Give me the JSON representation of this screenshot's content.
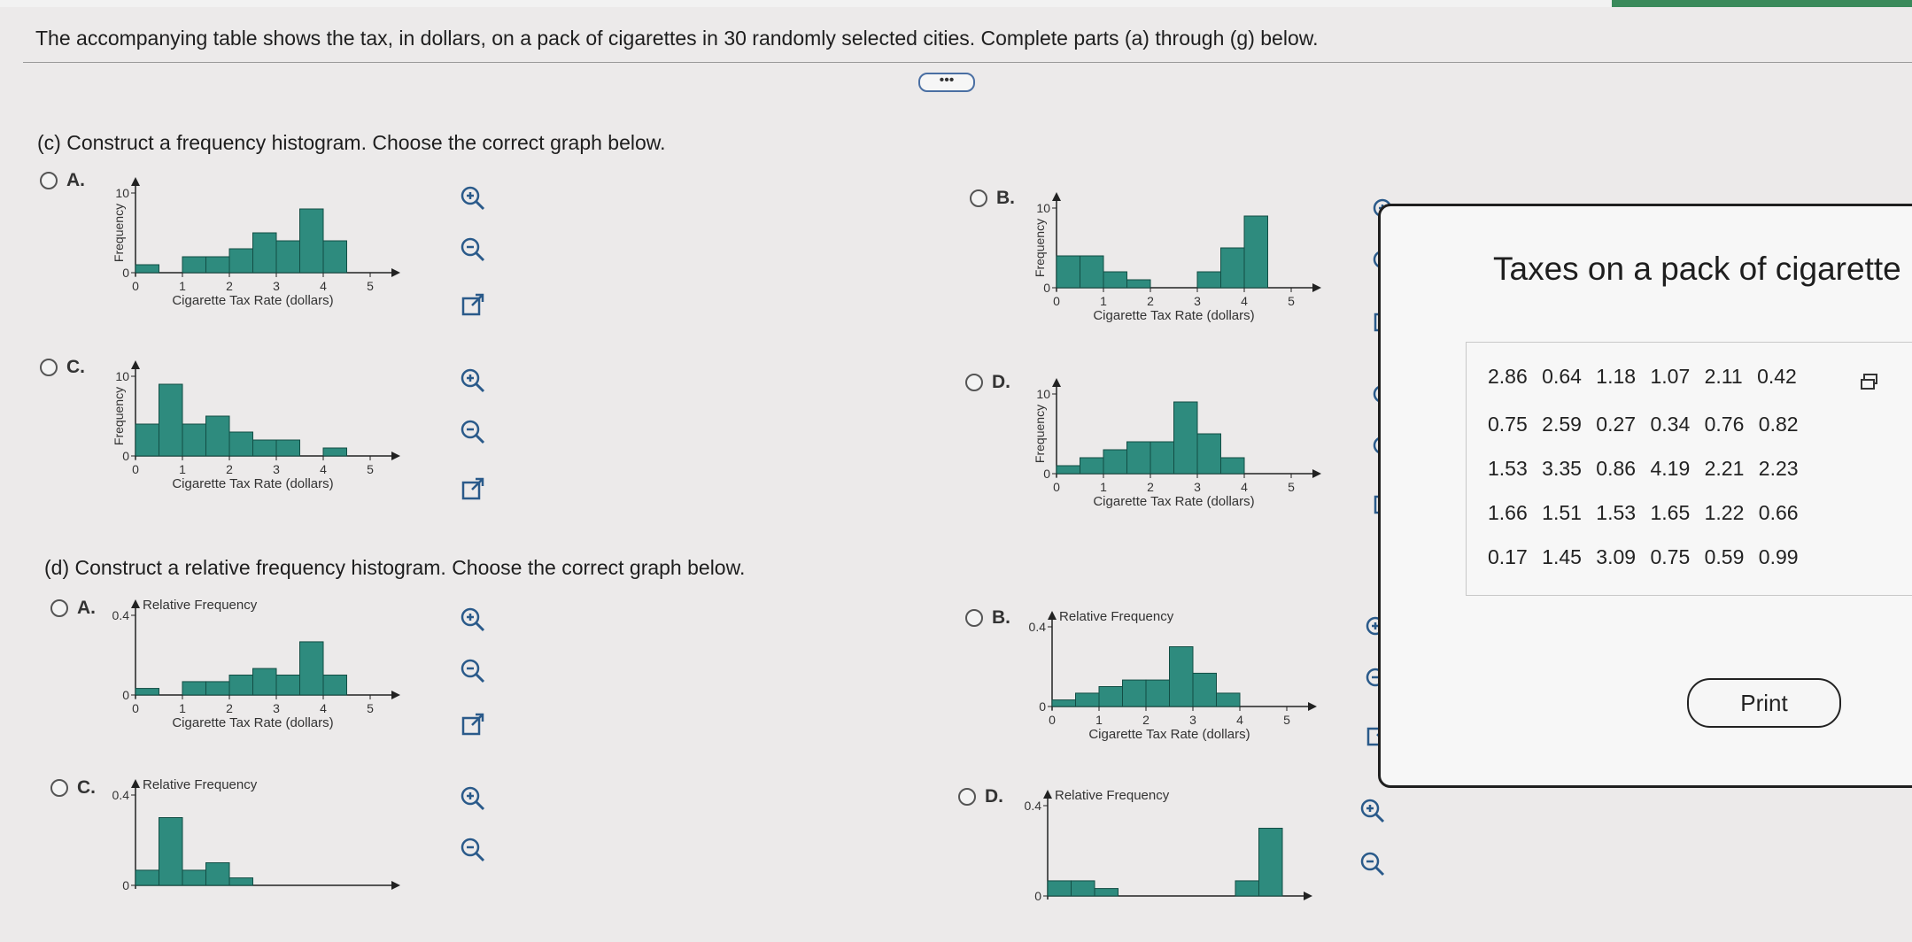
{
  "intro": "The accompanying table shows the tax, in dollars, on a pack of cigarettes in 30 randomly selected cities. Complete parts (a) through (g) below.",
  "more_button": "•••",
  "part_c": {
    "question": "(c) Construct a frequency histogram. Choose the correct graph below.",
    "options": {
      "A": "A.",
      "B": "B.",
      "C": "C.",
      "D": "D."
    }
  },
  "part_d": {
    "question": "(d) Construct a relative frequency histogram. Choose the correct graph below.",
    "options": {
      "A": "A.",
      "B": "B.",
      "C": "C.",
      "D": "D."
    }
  },
  "axis": {
    "xlabel": "Cigarette Tax Rate (dollars)",
    "ylabel_freq": "Frequency",
    "ylabel_rel": "Relative Frequency",
    "ymax_freq": "10",
    "ymax_rel": "0.4",
    "zero": "0",
    "xticks": [
      "0",
      "1",
      "2",
      "3",
      "4",
      "5"
    ]
  },
  "popup": {
    "title": "Taxes on a pack of cigarette",
    "rows": [
      "2.86 0.64 1.18 1.07 2.11 0.42",
      "0.75 2.59 0.27 0.34 0.76 0.82",
      "1.53 3.35 0.86 4.19 2.21 2.23",
      "1.66 1.51 1.53 1.65 1.22 0.66",
      "0.17 1.45 3.09 0.75 0.59 0.99"
    ],
    "print_label": "Print"
  },
  "chart_data": [
    {
      "type": "bar",
      "id": "c_A",
      "bin_edges": [
        0,
        0.5,
        1,
        1.5,
        2,
        2.5,
        3,
        3.5,
        4,
        4.5,
        5
      ],
      "values": [
        1,
        0,
        2,
        2,
        3,
        5,
        4,
        8,
        4,
        0
      ],
      "ylabel": "Frequency",
      "xlabel": "Cigarette Tax Rate (dollars)",
      "ylim": [
        0,
        10
      ]
    },
    {
      "type": "bar",
      "id": "c_B",
      "bin_edges": [
        0,
        0.5,
        1,
        1.5,
        2,
        2.5,
        3,
        3.5,
        4,
        4.5,
        5
      ],
      "values": [
        4,
        4,
        2,
        1,
        0,
        0,
        2,
        5,
        9,
        0
      ],
      "ylabel": "Frequency",
      "xlabel": "Cigarette Tax Rate (dollars)",
      "ylim": [
        0,
        10
      ]
    },
    {
      "type": "bar",
      "id": "c_C",
      "bin_edges": [
        0,
        0.5,
        1,
        1.5,
        2,
        2.5,
        3,
        3.5,
        4,
        4.5,
        5
      ],
      "values": [
        4,
        9,
        4,
        5,
        3,
        2,
        2,
        0,
        1,
        0
      ],
      "ylabel": "Frequency",
      "xlabel": "Cigarette Tax Rate (dollars)",
      "ylim": [
        0,
        10
      ]
    },
    {
      "type": "bar",
      "id": "c_D",
      "bin_edges": [
        0,
        0.5,
        1,
        1.5,
        2,
        2.5,
        3,
        3.5,
        4,
        4.5,
        5
      ],
      "values": [
        1,
        2,
        3,
        4,
        4,
        9,
        5,
        2,
        0,
        0
      ],
      "ylabel": "Frequency",
      "xlabel": "Cigarette Tax Rate (dollars)",
      "ylim": [
        0,
        10
      ]
    },
    {
      "type": "bar",
      "id": "d_A",
      "bin_edges": [
        0,
        0.5,
        1,
        1.5,
        2,
        2.5,
        3,
        3.5,
        4,
        4.5,
        5
      ],
      "values": [
        0.033,
        0,
        0.067,
        0.067,
        0.1,
        0.133,
        0.1,
        0.267,
        0.1,
        0
      ],
      "ylabel": "Relative Frequency",
      "xlabel": "Cigarette Tax Rate (dollars)",
      "ylim": [
        0,
        0.4
      ]
    },
    {
      "type": "bar",
      "id": "d_B",
      "bin_edges": [
        0,
        0.5,
        1,
        1.5,
        2,
        2.5,
        3,
        3.5,
        4,
        4.5,
        5
      ],
      "values": [
        0.033,
        0.067,
        0.1,
        0.133,
        0.133,
        0.3,
        0.167,
        0.067,
        0,
        0
      ],
      "ylabel": "Relative Frequency",
      "xlabel": "Cigarette Tax Rate (dollars)",
      "ylim": [
        0,
        0.4
      ]
    },
    {
      "type": "bar",
      "id": "d_C",
      "bin_edges": [
        0,
        0.5,
        1,
        1.5,
        2,
        2.5,
        3,
        3.5,
        4,
        4.5,
        5
      ],
      "values": [
        0.067,
        0.3,
        0.067,
        0.1,
        0.033,
        0,
        0,
        0,
        0,
        0
      ],
      "ylabel": "Relative Frequency",
      "ylim": [
        0,
        0.4
      ]
    },
    {
      "type": "bar",
      "id": "d_D",
      "bin_edges": [
        0,
        0.5,
        1,
        1.5,
        2,
        2.5,
        3,
        3.5,
        4,
        4.5,
        5
      ],
      "values": [
        0.067,
        0.067,
        0.033,
        0,
        0,
        0,
        0,
        0,
        0.067,
        0.3
      ],
      "ylabel": "Relative Frequency",
      "ylim": [
        0,
        0.4
      ]
    }
  ]
}
